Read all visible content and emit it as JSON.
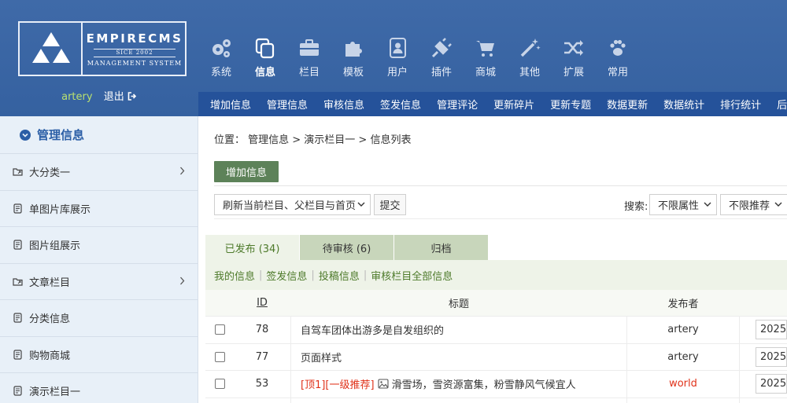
{
  "logo": {
    "title": "EMPIRECMS",
    "since": "SICE 2002",
    "subtitle": "MANAGEMENT SYSTEM"
  },
  "user": {
    "name": "artery",
    "logout": "退出"
  },
  "top_nav": [
    {
      "label": "系统",
      "icon": "gears-icon"
    },
    {
      "label": "信息",
      "icon": "copy-icon"
    },
    {
      "label": "栏目",
      "icon": "briefcase-icon"
    },
    {
      "label": "模板",
      "icon": "puzzle-icon"
    },
    {
      "label": "用户",
      "icon": "address-book-icon"
    },
    {
      "label": "插件",
      "icon": "plug-icon"
    },
    {
      "label": "商城",
      "icon": "cart-icon"
    },
    {
      "label": "其他",
      "icon": "magic-wand-icon"
    },
    {
      "label": "扩展",
      "icon": "shuffle-icon"
    },
    {
      "label": "常用",
      "icon": "paw-icon"
    }
  ],
  "sub_nav": [
    "增加信息",
    "管理信息",
    "审核信息",
    "签发信息",
    "管理评论",
    "更新碎片",
    "更新专题",
    "数据更新",
    "数据统计",
    "排行统计",
    "后台地"
  ],
  "sidebar": {
    "title": "管理信息",
    "items": [
      {
        "label": "大分类一",
        "type": "folder",
        "has_children": true
      },
      {
        "label": "单图片库展示",
        "type": "page"
      },
      {
        "label": "图片组展示",
        "type": "page"
      },
      {
        "label": "文章栏目",
        "type": "folder",
        "has_children": true
      },
      {
        "label": "分类信息",
        "type": "page"
      },
      {
        "label": "购物商城",
        "type": "page"
      },
      {
        "label": "演示栏目一",
        "type": "page"
      }
    ]
  },
  "breadcrumb": "位置： 管理信息 > 演示栏目一 > 信息列表",
  "add_button": "增加信息",
  "refresh_select": "刷新当前栏目、父栏目与首页",
  "submit_button": "提交",
  "search": {
    "label": "搜索:",
    "attr_select": "不限属性",
    "rec_select": "不限推荐"
  },
  "tabs": [
    {
      "label": "已发布 (34)",
      "active": true
    },
    {
      "label": "待审核 (6)",
      "active": false
    },
    {
      "label": "归档",
      "active": false
    }
  ],
  "filters": [
    "我的信息",
    "签发信息",
    "投稿信息",
    "审核栏目全部信息"
  ],
  "table": {
    "headers": {
      "id": "ID",
      "title": "标题",
      "publisher": "发布者"
    },
    "rows": [
      {
        "id": "78",
        "tags": "",
        "has_pic": false,
        "title": "自驾车团体出游多是自发组织的",
        "publisher": "artery",
        "date": "2025-",
        "publisher_red": false
      },
      {
        "id": "77",
        "tags": "",
        "has_pic": false,
        "title": "页面样式",
        "publisher": "artery",
        "date": "2025-",
        "publisher_red": false
      },
      {
        "id": "53",
        "tags": "[顶1][一级推荐]",
        "has_pic": true,
        "title": "滑雪场，雪资源富集，粉雪静风气候宜人",
        "publisher": "world",
        "date": "2025-",
        "publisher_red": true
      }
    ]
  },
  "colors": {
    "header_bg": "#3d68a6",
    "subnav_bg": "#25529a",
    "sidebar_bg": "#e8f0f8",
    "accent_green": "#5d8259",
    "tab_inactive": "#c8d6bb",
    "tab_active": "#eef3e8",
    "link_green": "#4d7a2a",
    "highlight_red": "#e0321a"
  }
}
